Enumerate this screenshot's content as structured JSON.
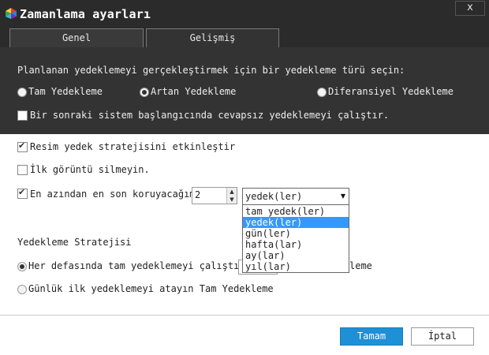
{
  "window": {
    "title": "Zamanlama ayarları",
    "close_label": "x"
  },
  "tabs": [
    {
      "label": "Genel",
      "active": false
    },
    {
      "label": "Gelişmiş",
      "active": true
    }
  ],
  "backup_type": {
    "prompt": "Planlanan yedeklemeyi gerçekleştirmek için bir yedekleme türü seçin:",
    "options": [
      {
        "label": "Tam Yedekleme",
        "selected": false
      },
      {
        "label": "Artan Yedekleme",
        "selected": true
      },
      {
        "label": "Diferansiyel Yedekleme",
        "selected": false
      }
    ],
    "startup_checkbox": {
      "label": "Bir sonraki sistem başlangıcında cevapsız yedeklemeyi çalıştır.",
      "checked": false
    }
  },
  "image_strategy": {
    "enable": {
      "label": "Resim yedek stratejisini etkinleştir",
      "checked": true
    },
    "keep_first": {
      "label": "İlk görüntü silmeyin.",
      "checked": false
    },
    "keep_latest": {
      "label": "En azından en son koruyacağım",
      "checked": true
    },
    "keep_count": "2",
    "unit": {
      "selected": "yedek(ler)",
      "options": [
        "tam yedek(ler)",
        "yedek(ler)",
        "gün(ler)",
        "hafta(lar)",
        "ay(lar)",
        "yıl(lar)"
      ],
      "highlighted_index": 1
    }
  },
  "backup_strategy": {
    "heading": "Yedekleme Stratejisi",
    "option_every": {
      "label": "Her defasında tam yedeklemeyi çalıştırın",
      "trailing": "leme",
      "selected": true
    },
    "option_daily": {
      "label": "Günlük ilk yedeklemeyi atayın Tam Yedekleme",
      "selected": false
    }
  },
  "buttons": {
    "ok": "Tamam",
    "cancel": "İptal"
  },
  "colors": {
    "titlebar": "#2b2b2b",
    "panel": "#333333",
    "accent": "#1e90d6",
    "highlight": "#3399ff"
  }
}
